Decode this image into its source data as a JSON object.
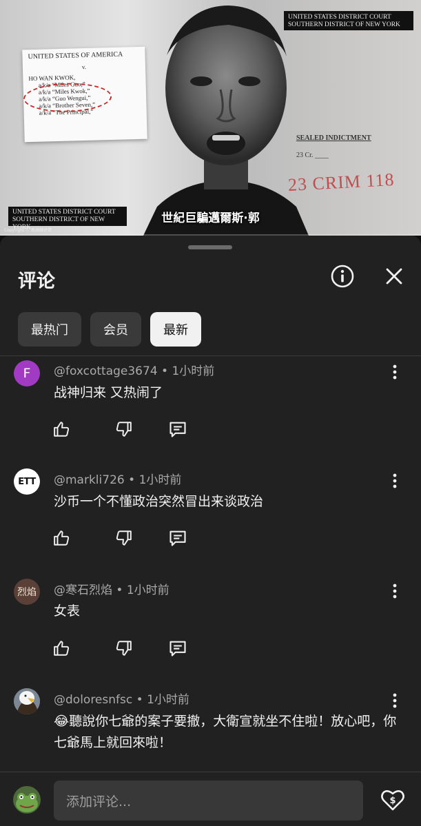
{
  "video": {
    "subtitle": "世紀巨騙邁爾斯·郭",
    "copyright": "Copyright ⓒ 新闻辣评哥",
    "document": {
      "header": "UNITED STATES OF AMERICA",
      "versus": "v.",
      "name": "HO WAN KWOK,",
      "aliases": [
        "a/k/a “Miles Guo,”",
        "a/k/a “Miles Kwok,”",
        "a/k/a “Guo Wengui,”",
        "a/k/a “Brother Seven,”",
        "a/k/a “The Principal,”"
      ]
    },
    "court_top": [
      "UNITED STATES DISTRICT COURT",
      "SOUTHERN DISTRICT OF NEW YORK"
    ],
    "court_bottom": [
      "UNITED STATES DISTRICT COURT",
      "SOUTHERN DISTRICT OF NEW YORK"
    ],
    "sealed": "SEALED INDICTMENT",
    "case_no": "23 Cr. ____",
    "stamp": "23 CRIM  118"
  },
  "sheet": {
    "title": "评论",
    "info_icon": "info-icon",
    "close_icon": "close-icon",
    "tabs": [
      {
        "label": "最热门",
        "active": false
      },
      {
        "label": "会员",
        "active": false
      },
      {
        "label": "最新",
        "active": true
      }
    ]
  },
  "comments": [
    {
      "author": "@foxcottage3674",
      "time": "1小时前",
      "text": "战神归来 又热闹了",
      "avatar_letter": "F",
      "avatar_color": "#a23bc4"
    },
    {
      "author": "@markli726",
      "time": "1小时前",
      "text": "沙币一个不懂政治突然冒出来谈政治",
      "avatar_letter": "ETT",
      "avatar_color": "#ffffff"
    },
    {
      "author": "@寒石烈焰",
      "time": "1小时前",
      "text": "女表",
      "avatar_letter": "烈焰",
      "avatar_color": "#5a4036"
    },
    {
      "author": "@doloresnfsc",
      "time": "1小时前",
      "text": "😂聽說你七爺的案子要撤，大衛宣就坐不住啦！放心吧，你七爺馬上就回來啦！",
      "avatar_letter": "",
      "avatar_color": "#6b7a86"
    }
  ],
  "composer": {
    "placeholder": "添加评论..."
  }
}
